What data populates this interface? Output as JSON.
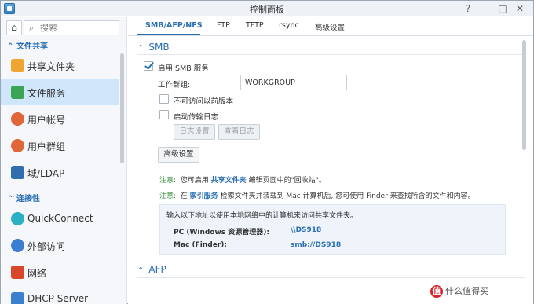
{
  "window": {
    "title": "控制面板",
    "buttons": [
      "?",
      "—",
      "□",
      "✕"
    ]
  },
  "sidebar": {
    "search_placeholder": "搜索",
    "sections": [
      {
        "label": "文件共享"
      },
      {
        "label": "连接性"
      }
    ],
    "items": [
      {
        "label": "共享文件夹",
        "icon": "shared-folder-icon",
        "color": "#f0a431"
      },
      {
        "label": "文件服务",
        "icon": "file-services-icon",
        "color": "#3aa655",
        "active": true
      },
      {
        "label": "用户帐号",
        "icon": "user-icon",
        "color": "#e0663a"
      },
      {
        "label": "用户群组",
        "icon": "group-icon",
        "color": "#e0663a"
      },
      {
        "label": "域/LDAP",
        "icon": "domain-icon",
        "color": "#2f6fae"
      },
      {
        "label": "QuickConnect",
        "icon": "quickconnect-icon",
        "color": "#2bb0c4"
      },
      {
        "label": "外部访问",
        "icon": "globe-icon",
        "color": "#3b7fd0"
      },
      {
        "label": "网络",
        "icon": "network-icon",
        "color": "#d9472b"
      },
      {
        "label": "DHCP Server",
        "icon": "dhcp-icon",
        "color": "#3b7fd0"
      }
    ]
  },
  "tabs": [
    "SMB/AFP/NFS",
    "FTP",
    "TFTP",
    "rsync",
    "高级设置"
  ],
  "smb": {
    "header": "SMB",
    "enable_label": "启用 SMB 服务",
    "enabled": true,
    "workgroup_label": "工作群组:",
    "workgroup_value": "WORKGROUP",
    "hide_prev_label": "不可访问以前版本",
    "transfer_log_label": "启动传输日志",
    "log_settings": "日志设置",
    "view_log": "查看日志",
    "advanced": "高级设置",
    "note1_key": "注意:",
    "note1_pre": "您可启用",
    "note1_link": "共享文件夹",
    "note1_post": "编辑页面中的\"回收站\"。",
    "note2_key": "注意:",
    "note2_pre": "在",
    "note2_link": "索引服务",
    "note2_post": "检索文件夹并装载到 Mac 计算机后, 您可使用 Finder 来查找所含的文件和内容。",
    "info_title": "输入以下地址以使用本地网络中的计算机来访问共享文件夹。",
    "pc_label": "PC (Windows 资源管理器):",
    "pc_value": "\\\\DS918",
    "mac_label": "Mac (Finder):",
    "mac_value": "smb://DS918"
  },
  "afp": {
    "header": "AFP"
  },
  "watermark": {
    "logo": "值",
    "text": "什么值得买"
  }
}
